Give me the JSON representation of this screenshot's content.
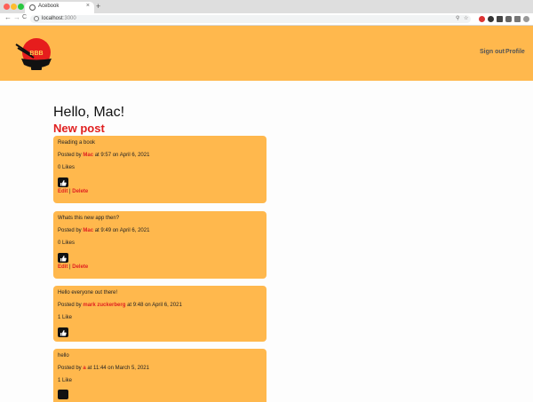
{
  "browser": {
    "tab_title": "Acebook",
    "tab_close": "×",
    "new_tab": "+",
    "url_host": "localhost",
    "url_port": ":3000",
    "back": "←",
    "forward": "→",
    "reload": "C"
  },
  "header": {
    "logo_text": "BBB",
    "nav": {
      "sign_out": "Sign out",
      "profile": "Profile"
    },
    "colors": {
      "bar": "#ffb84d",
      "accent": "#e02020"
    }
  },
  "main": {
    "greeting": "Hello, Mac!",
    "new_post": "New post"
  },
  "posts": [
    {
      "content": "Reading a book",
      "posted_by": "Posted by",
      "author": "Mac",
      "time_text": "at  9:57 on April  6, 2021",
      "likes": "0 Likes",
      "edit": "Edit",
      "sep": "|",
      "delete": "Delete"
    },
    {
      "content": "Whats this new app then?",
      "posted_by": "Posted by",
      "author": "Mac",
      "time_text": "at  9:49 on April  6, 2021",
      "likes": "0 Likes",
      "edit": "Edit",
      "sep": "|",
      "delete": "Delete"
    },
    {
      "content": "Hello everyone out there!",
      "posted_by": "Posted by",
      "author": "mark zuckerberg",
      "time_text": "at  9:48 on April  6, 2021",
      "likes": "1 Like"
    },
    {
      "content": "hello",
      "posted_by": "Posted by",
      "author": "a",
      "time_text": "at 11:44 on March  5, 2021",
      "likes": "1 Like"
    }
  ]
}
